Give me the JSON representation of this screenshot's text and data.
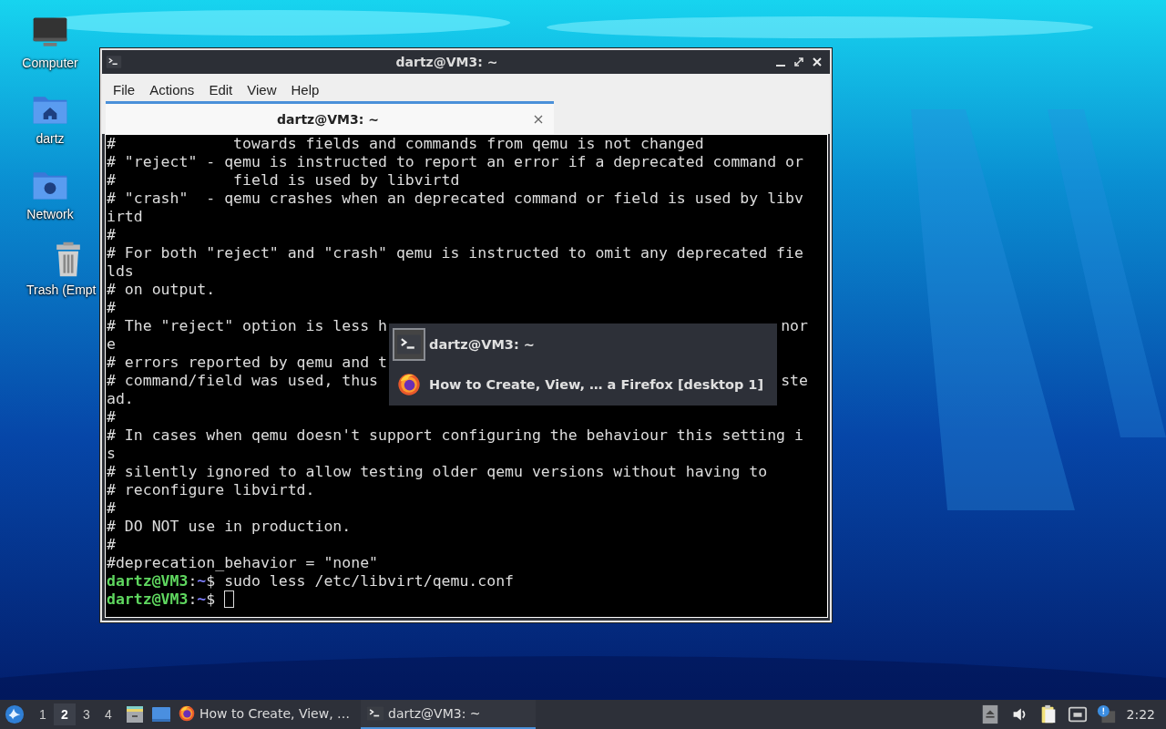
{
  "desktop_icons": [
    {
      "label": "Computer",
      "kind": "computer"
    },
    {
      "label": "dartz",
      "kind": "home"
    },
    {
      "label": "Network",
      "kind": "network"
    },
    {
      "label": "Trash (Empt",
      "kind": "trash"
    }
  ],
  "window": {
    "title": "dartz@VM3: ~",
    "menu": [
      "File",
      "Actions",
      "Edit",
      "View",
      "Help"
    ],
    "tabs": [
      {
        "label": "dartz@VM3: ~",
        "selected": true
      }
    ],
    "terminal": {
      "lines": [
        {
          "kind": "text",
          "text": "#             towards fields and commands from qemu is not changed"
        },
        {
          "kind": "text",
          "text": "# \"reject\" - qemu is instructed to report an error if a deprecated command or"
        },
        {
          "kind": "text",
          "text": "#             field is used by libvirtd"
        },
        {
          "kind": "text",
          "text": "# \"crash\"  - qemu crashes when an deprecated command or field is used by libv"
        },
        {
          "kind": "text",
          "text": "irtd"
        },
        {
          "kind": "text",
          "text": "#"
        },
        {
          "kind": "text",
          "text": "# For both \"reject\" and \"crash\" qemu is instructed to omit any deprecated fie"
        },
        {
          "kind": "text",
          "text": "lds"
        },
        {
          "kind": "text",
          "text": "# on output."
        },
        {
          "kind": "text",
          "text": "#"
        },
        {
          "kind": "text",
          "text": "# The \"reject\" option is less h",
          "tail": "nor"
        },
        {
          "kind": "text",
          "text": "e"
        },
        {
          "kind": "text",
          "text": "# errors reported by qemu and t"
        },
        {
          "kind": "text",
          "text": "# command/field was used, thus",
          "tail": "ste"
        },
        {
          "kind": "text",
          "text": "ad."
        },
        {
          "kind": "text",
          "text": "#"
        },
        {
          "kind": "text",
          "text": "# In cases when qemu doesn't support configuring the behaviour this setting i"
        },
        {
          "kind": "text",
          "text": "s"
        },
        {
          "kind": "text",
          "text": "# silently ignored to allow testing older qemu versions without having to"
        },
        {
          "kind": "text",
          "text": "# reconfigure libvirtd."
        },
        {
          "kind": "text",
          "text": "#"
        },
        {
          "kind": "text",
          "text": "# DO NOT use in production."
        },
        {
          "kind": "text",
          "text": "#"
        },
        {
          "kind": "text",
          "text": "#deprecation_behavior = \"none\""
        },
        {
          "kind": "prompt",
          "user": "dartz@VM3",
          "separator": ":",
          "path": "~",
          "command": "$ sudo less /etc/libvirt/qemu.conf",
          "cursor": false
        },
        {
          "kind": "prompt",
          "user": "dartz@VM3",
          "separator": ":",
          "path": "~",
          "command": "$",
          "cursor": true
        }
      ]
    }
  },
  "window_switcher": {
    "items": [
      {
        "label": "dartz@VM3: ~",
        "kind": "terminal",
        "selected": true
      },
      {
        "label": "How to Create, View, … a Firefox [desktop 1]",
        "kind": "firefox",
        "selected": false
      }
    ]
  },
  "taskbar": {
    "workspaces": [
      {
        "label": "1",
        "selected": false
      },
      {
        "label": "2",
        "selected": true
      },
      {
        "label": "3",
        "selected": false
      },
      {
        "label": "4",
        "selected": false
      }
    ],
    "tasks": [
      {
        "label": "How to Create, View, …",
        "kind": "firefox",
        "selected": false
      },
      {
        "label": "dartz@VM3: ~",
        "kind": "terminal",
        "selected": true
      }
    ],
    "clock": "2:22"
  }
}
